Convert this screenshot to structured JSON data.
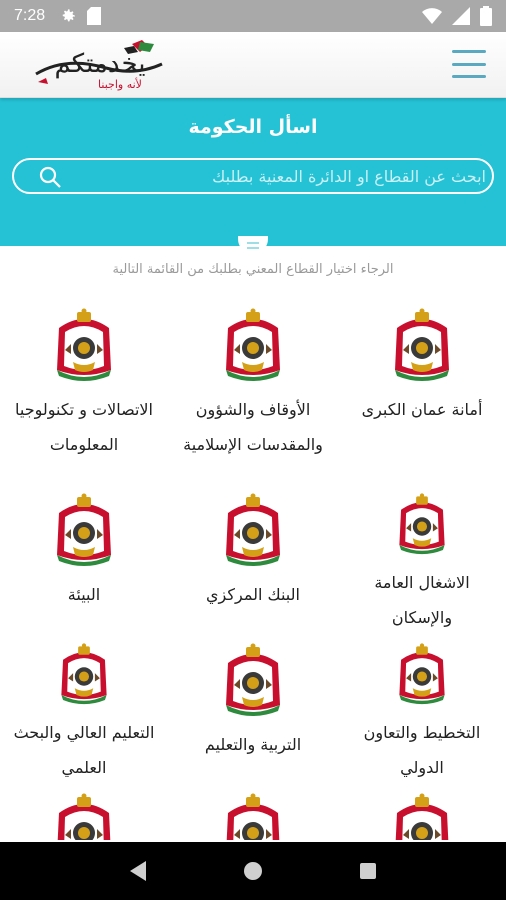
{
  "status_bar": {
    "time": "7:28",
    "icons": [
      "settings-gear-icon",
      "sd-card-icon",
      "wifi-icon",
      "signal-icon",
      "battery-icon"
    ]
  },
  "header": {
    "logo_text": "يخدمتكم",
    "logo_subtext": "لأنه واجبنا",
    "menu_icon": "hamburger-menu-icon"
  },
  "search_section": {
    "title": "اسأل الحكومة",
    "placeholder": "ابحث عن القطاع او الدائرة المعنية بطلبك",
    "search_icon": "search-icon"
  },
  "hint": "الرجاء اختيار القطاع المعني بطلبك من القائمة التالية",
  "sectors": [
    {
      "label": "أمانة عمان الكبرى",
      "icon": "jordan-coat-of-arms-icon"
    },
    {
      "label": "الأوقاف والشؤون والمقدسات الإسلامية",
      "icon": "jordan-coat-of-arms-icon"
    },
    {
      "label": "الاتصالات و تكنولوجيا المعلومات",
      "icon": "jordan-coat-of-arms-icon"
    },
    {
      "label": "الاشغال العامة والإسكان",
      "icon": "jordan-coat-of-arms-icon"
    },
    {
      "label": "البنك المركزي",
      "icon": "jordan-coat-of-arms-icon"
    },
    {
      "label": "البيئة",
      "icon": "jordan-coat-of-arms-icon"
    },
    {
      "label": "التخطيط والتعاون الدولي",
      "icon": "jordan-coat-of-arms-icon"
    },
    {
      "label": "التربية والتعليم",
      "icon": "jordan-coat-of-arms-icon"
    },
    {
      "label": "التعليم العالي والبحث العلمي",
      "icon": "jordan-coat-of-arms-icon"
    },
    {
      "label": "",
      "icon": "jordan-coat-of-arms-icon"
    },
    {
      "label": "",
      "icon": "jordan-coat-of-arms-icon"
    },
    {
      "label": "",
      "icon": "jordan-coat-of-arms-icon"
    }
  ],
  "nav_bar": {
    "buttons": [
      "back-icon",
      "home-icon",
      "recents-icon"
    ]
  },
  "colors": {
    "accent": "#25c2d6",
    "status_bar": "#a9a9a9",
    "nav_bar": "#000000",
    "emblem_red": "#c8102e",
    "emblem_gold": "#d4a017"
  }
}
